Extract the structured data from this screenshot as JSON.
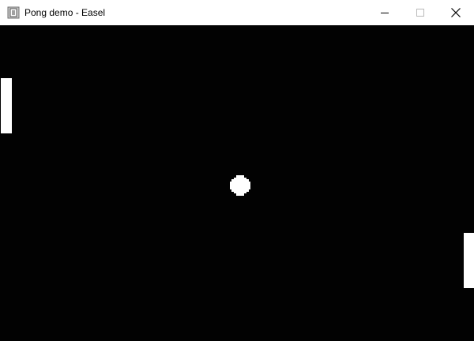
{
  "window": {
    "title": "Pong demo - Easel",
    "app_icon": "easel-app-icon",
    "controls": {
      "minimize_icon": "minimize-icon",
      "maximize_icon": "maximize-icon",
      "close_icon": "close-icon"
    }
  },
  "game": {
    "background_color": "#020202",
    "foreground_color": "#ffffff",
    "left_paddle": "paddle",
    "right_paddle": "paddle",
    "ball": "ball"
  }
}
